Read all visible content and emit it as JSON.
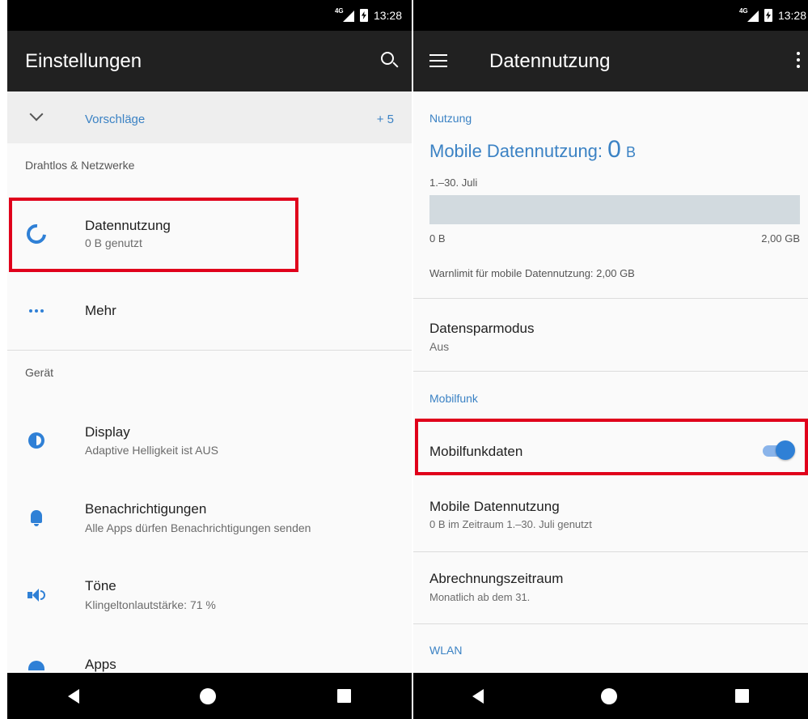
{
  "left": {
    "status": {
      "network": "4G",
      "time": "13:28"
    },
    "appbar": {
      "title": "Einstellungen"
    },
    "suggestions": {
      "label": "Vorschläge",
      "count": "+ 5"
    },
    "sections": {
      "wireless": "Drahtlos & Netzwerke",
      "device": "Gerät"
    },
    "items": {
      "data_usage": {
        "title": "Datennutzung",
        "subtitle": "0 B genutzt"
      },
      "more": {
        "title": "Mehr"
      },
      "display": {
        "title": "Display",
        "subtitle": "Adaptive Helligkeit ist AUS"
      },
      "notifications": {
        "title": "Benachrichtigungen",
        "subtitle": "Alle Apps dürfen Benachrichtigungen senden"
      },
      "sounds": {
        "title": "Töne",
        "subtitle": "Klingeltonlautstärke: 71 %"
      },
      "apps": {
        "title": "Apps"
      }
    }
  },
  "right": {
    "status": {
      "network": "4G",
      "time": "13:28"
    },
    "appbar": {
      "title": "Datennutzung"
    },
    "usage": {
      "header": "Nutzung",
      "label": "Mobile Datennutzung: ",
      "amount": "0",
      "unit": "B",
      "period": "1.–30. Juli",
      "bar_min": "0 B",
      "bar_max": "2,00 GB",
      "used_fraction": 0,
      "warning": "Warnlimit für mobile Datennutzung: 2,00 GB"
    },
    "data_saver": {
      "title": "Datensparmodus",
      "subtitle": "Aus"
    },
    "mobile_section": "Mobilfunk",
    "mobile_data": {
      "title": "Mobilfunkdaten",
      "enabled": true
    },
    "mobile_usage": {
      "title": "Mobile Datennutzung",
      "subtitle": "0 B im Zeitraum 1.–30. Juli genutzt"
    },
    "billing": {
      "title": "Abrechnungszeitraum",
      "subtitle": "Monatlich ab dem 31."
    },
    "wlan_section": "WLAN"
  },
  "colors": {
    "accent": "#2f80d6",
    "highlight": "#e0001b",
    "appbar": "#212121"
  },
  "icons": [
    "search-icon",
    "chevron-down-icon",
    "data-usage-icon",
    "more-dots-icon",
    "display-icon",
    "bell-icon",
    "speaker-icon",
    "android-icon",
    "menu-icon",
    "overflow-menu-icon"
  ]
}
